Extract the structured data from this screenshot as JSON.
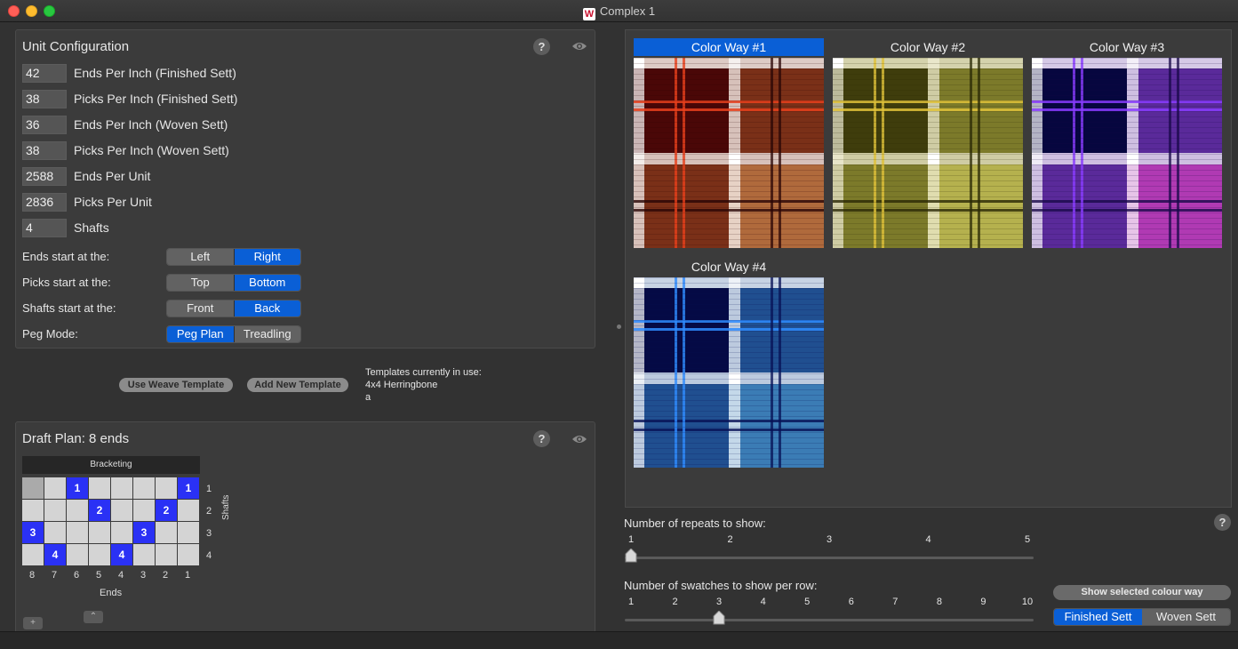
{
  "window": {
    "title": "Complex 1",
    "app_icon": "W"
  },
  "unit_config": {
    "title": "Unit Configuration",
    "fields": [
      {
        "value": "42",
        "label": "Ends Per Inch (Finished Sett)"
      },
      {
        "value": "38",
        "label": "Picks Per Inch (Finished Sett)"
      },
      {
        "value": "36",
        "label": "Ends Per Inch (Woven Sett)"
      },
      {
        "value": "38",
        "label": "Picks Per Inch (Woven Sett)"
      },
      {
        "value": "2588",
        "label": "Ends Per Unit"
      },
      {
        "value": "2836",
        "label": "Picks Per Unit"
      },
      {
        "value": "4",
        "label": "Shafts"
      }
    ],
    "segments": [
      {
        "label": "Ends start at the:",
        "options": [
          "Left",
          "Right"
        ],
        "selected": 1
      },
      {
        "label": "Picks start at the:",
        "options": [
          "Top",
          "Bottom"
        ],
        "selected": 1
      },
      {
        "label": "Shafts start at the:",
        "options": [
          "Front",
          "Back"
        ],
        "selected": 1
      },
      {
        "label": "Peg Mode:",
        "options": [
          "Peg Plan",
          "Treadling"
        ],
        "selected": 0
      }
    ]
  },
  "templates": {
    "use_button": "Use Weave Template",
    "add_button": "Add New Template",
    "in_use_label": "Templates currently in use:",
    "in_use_items": [
      "4x4 Herringbone",
      "a"
    ]
  },
  "draft_plan": {
    "title": "Draft Plan:  8 ends",
    "bracketing": "Bracketing",
    "shafts_label": "Shafts",
    "ends_label": "Ends",
    "end_numbers": [
      "8",
      "7",
      "6",
      "5",
      "4",
      "3",
      "2",
      "1"
    ],
    "shaft_numbers": [
      "1",
      "2",
      "3",
      "4"
    ],
    "threading": [
      {
        "col": 2,
        "row": 0,
        "label": "1"
      },
      {
        "col": 7,
        "row": 0,
        "label": "1"
      },
      {
        "col": 3,
        "row": 1,
        "label": "2"
      },
      {
        "col": 6,
        "row": 1,
        "label": "2"
      },
      {
        "col": 0,
        "row": 2,
        "label": "3"
      },
      {
        "col": 5,
        "row": 2,
        "label": "3"
      },
      {
        "col": 1,
        "row": 3,
        "label": "4"
      },
      {
        "col": 4,
        "row": 3,
        "label": "4"
      }
    ],
    "highlight_cell": {
      "col": 0,
      "row": 0
    }
  },
  "colorways": [
    {
      "title": "Color Way #1",
      "selected": true,
      "colors": {
        "block_a": "#4a0707",
        "block_b": "#b06a3c",
        "mix_ab": "#7a3018",
        "accent": "#e8401c",
        "stripe_dark": "#2a0606",
        "light": "#ffffff"
      }
    },
    {
      "title": "Color Way #2",
      "selected": false,
      "colors": {
        "block_a": "#3f3d0c",
        "block_b": "#b5b14e",
        "mix_ab": "#7c7a2a",
        "accent": "#e0c23a",
        "stripe_dark": "#2a2906",
        "light": "#f2f0d8"
      }
    },
    {
      "title": "Color Way #3",
      "selected": false,
      "colors": {
        "block_a": "#06063f",
        "block_b": "#b03ab3",
        "mix_ab": "#5a2a9a",
        "accent": "#8a3cff",
        "stripe_dark": "#1a0a4a",
        "light": "#ffffff"
      }
    },
    {
      "title": "Color Way #4",
      "selected": false,
      "colors": {
        "block_a": "#050a45",
        "block_b": "#3b7cb5",
        "mix_ab": "#204f90",
        "accent": "#2f8cff",
        "stripe_dark": "#071055",
        "light": "#ffffff"
      }
    }
  ],
  "repeats_slider": {
    "label": "Number of repeats to show:",
    "ticks": [
      "1",
      "2",
      "3",
      "4",
      "5"
    ],
    "value": 1
  },
  "swatches_slider": {
    "label": "Number of swatches to show per row:",
    "ticks": [
      "1",
      "2",
      "3",
      "4",
      "5",
      "6",
      "7",
      "8",
      "9",
      "10"
    ],
    "value": 3
  },
  "show_selected_button": "Show selected colour way",
  "sett_toggle": {
    "options": [
      "Finished Sett",
      "Woven Sett"
    ],
    "selected": 0
  },
  "help_glyph": "?"
}
